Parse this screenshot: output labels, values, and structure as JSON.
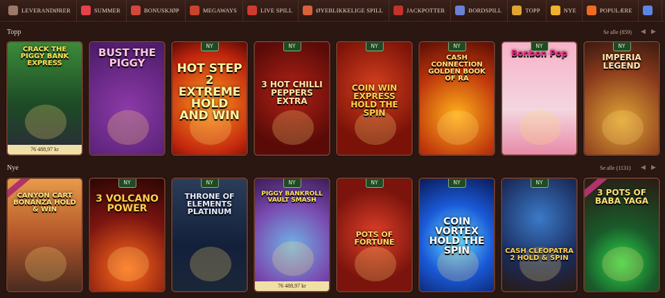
{
  "nav": {
    "items": [
      {
        "label": "LEVERANDØRER",
        "icon": "providers-icon",
        "color": "#9a7a66"
      },
      {
        "label": "SUMMER",
        "icon": "watermelon-icon",
        "color": "#e6424a"
      },
      {
        "label": "BONUSKJØP",
        "icon": "gift-icon",
        "color": "#d4473a"
      },
      {
        "label": "MEGAWAYS",
        "icon": "megaways-icon",
        "color": "#c9442b"
      },
      {
        "label": "LIVE SPILL",
        "icon": "live-chip-icon",
        "color": "#d23a2f"
      },
      {
        "label": "ØYEBLIKKELIGE SPILL",
        "icon": "joystick-icon",
        "color": "#d6613a"
      },
      {
        "label": "JACKPOTTER",
        "icon": "seven-icon",
        "color": "#c0332b"
      },
      {
        "label": "BORDSPILL",
        "icon": "cards-icon",
        "color": "#6a7fd6"
      },
      {
        "label": "TOPP",
        "icon": "crown-icon",
        "color": "#e0a531"
      },
      {
        "label": "NYE",
        "icon": "lightning-icon",
        "color": "#f0b12c"
      },
      {
        "label": "POPULÆRE",
        "icon": "fire-icon",
        "color": "#ef6b22"
      },
      {
        "label": "",
        "icon": "diamond-icon",
        "color": "#5b86e5"
      }
    ]
  },
  "sections": [
    {
      "title": "Topp",
      "see_all": "Se alle (859)",
      "games": [
        {
          "title": "CRACK THE PIGGY BANK EXPRESS",
          "badge": "",
          "jackpot": "76 488,97 kr",
          "exclusive": false
        },
        {
          "title": "BUST THE PIGGY",
          "badge": "",
          "jackpot": "",
          "exclusive": false
        },
        {
          "title": "HOT STEP 2 EXTREME HOLD AND WIN",
          "badge": "NY",
          "jackpot": "",
          "exclusive": false
        },
        {
          "title": "3 HOT CHILLI PEPPERS EXTRA",
          "badge": "NY",
          "jackpot": "",
          "exclusive": false
        },
        {
          "title": "COIN WIN EXPRESS HOLD THE SPIN",
          "badge": "NY",
          "jackpot": "",
          "exclusive": false
        },
        {
          "title": "CASH CONNECTION GOLDEN BOOK OF RA",
          "badge": "NY",
          "jackpot": "",
          "exclusive": false
        },
        {
          "title": "Bonbon Pop",
          "badge": "NY",
          "jackpot": "",
          "exclusive": false
        },
        {
          "title": "IMPERIA LEGEND",
          "badge": "NY",
          "jackpot": "",
          "exclusive": false
        }
      ]
    },
    {
      "title": "Nye",
      "see_all": "Se alle (1131)",
      "games": [
        {
          "title": "CANYON CART BONANZA HOLD & WIN",
          "badge": "",
          "jackpot": "",
          "exclusive": true
        },
        {
          "title": "3 VOLCANO POWER",
          "badge": "NY",
          "jackpot": "",
          "exclusive": false
        },
        {
          "title": "THRONE OF ELEMENTS PLATINUM",
          "badge": "NY",
          "jackpot": "",
          "exclusive": false
        },
        {
          "title": "PIGGY BANKROLL VAULT SMASH",
          "badge": "NY",
          "jackpot": "76 488,97 kr",
          "exclusive": false
        },
        {
          "title": "POTS OF FORTUNE",
          "badge": "NY",
          "jackpot": "",
          "exclusive": false
        },
        {
          "title": "COIN VORTEX HOLD THE SPIN",
          "badge": "NY",
          "jackpot": "",
          "exclusive": false
        },
        {
          "title": "CASH CLEOPATRA 2 HOLD & SPIN",
          "badge": "NY",
          "jackpot": "",
          "exclusive": false
        },
        {
          "title": "3 POTS OF BABA YAGA",
          "badge": "",
          "jackpot": "",
          "exclusive": true
        }
      ]
    }
  ]
}
